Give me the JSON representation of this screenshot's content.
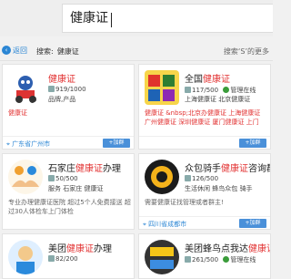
{
  "search": {
    "value": "健康证"
  },
  "nav": {
    "back_label": "返回",
    "crumb_prefix": "搜索:",
    "crumb_keyword": "健康证",
    "right_label": "搜索‘S’的更多"
  },
  "cards": [
    {
      "title_hl": "健康证",
      "title_rest": "",
      "members": "919/1000",
      "tags": "品牌,产品",
      "desc_hl": "健康证",
      "desc_rest": "",
      "location": "广东省广州市",
      "join": "+加群"
    },
    {
      "title_pre": "全国",
      "title_hl": "健康证",
      "title_rest": "",
      "members": "117/500",
      "status": "管理在线",
      "tags": "上海健康证 北京健康证",
      "desc": "健康证 &nbsp;北京办健康证 上海健康证 广州健康证 深圳健康证 厦门健康证 上门",
      "location": "",
      "join": "+加群"
    },
    {
      "title_pre": "石家庄",
      "title_hl": "健康证",
      "title_rest": "办理",
      "members": "50/500",
      "tags": "服务  石家庄 健康证",
      "desc": "专业办理健康证医院 超过5个人免费接送 超过30人体检车上门体检",
      "location": "",
      "join": ""
    },
    {
      "title_pre": "众包骑手",
      "title_hl": "健康证",
      "title_rest": "咨询群",
      "members": "126/500",
      "tags": "生活休闲  蜂鸟众包  骑手",
      "desc": "需要健康证找管理或者群主!",
      "location": "四川省成都市",
      "join": "+加群"
    },
    {
      "title_pre": "美团",
      "title_hl": "健康证",
      "title_rest": "办理",
      "members": "82/200",
      "tags": "",
      "desc": "",
      "location": "",
      "join": ""
    },
    {
      "title_pre": "美团蜂鸟点我达",
      "title_hl": "健康证",
      "title_rest": "",
      "members": "261/500",
      "status": "管理在线",
      "tags": "",
      "desc": "",
      "location": "",
      "join": ""
    }
  ]
}
